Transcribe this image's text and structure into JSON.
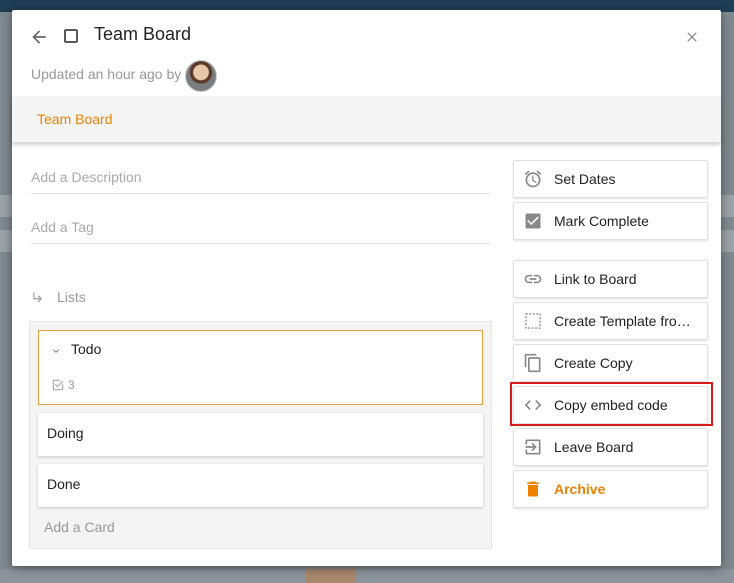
{
  "header": {
    "title": "Team Board",
    "updated": "Updated an hour ago by"
  },
  "breadcrumb": {
    "board": "Team Board"
  },
  "fields": {
    "description_placeholder": "Add a Description",
    "tag_placeholder": "Add a Tag"
  },
  "lists": {
    "heading": "Lists",
    "items": [
      {
        "label": "Todo",
        "count": "3"
      },
      {
        "label": "Doing"
      },
      {
        "label": "Done"
      }
    ],
    "add_card": "Add a Card"
  },
  "actions": [
    {
      "label": "Set Dates",
      "icon": "alarm-clock-icon"
    },
    {
      "label": "Mark Complete",
      "icon": "checkbox-checked-icon"
    },
    {
      "label": "Link to Board",
      "icon": "link-icon"
    },
    {
      "label": "Create Template fro…",
      "icon": "template-icon"
    },
    {
      "label": "Create Copy",
      "icon": "copy-icon"
    },
    {
      "label": "Copy embed code",
      "icon": "code-icon"
    },
    {
      "label": "Leave Board",
      "icon": "exit-icon"
    },
    {
      "label": "Archive",
      "icon": "trash-icon"
    }
  ],
  "colors": {
    "accent": "#f08000",
    "highlight": "#d81b1b"
  }
}
